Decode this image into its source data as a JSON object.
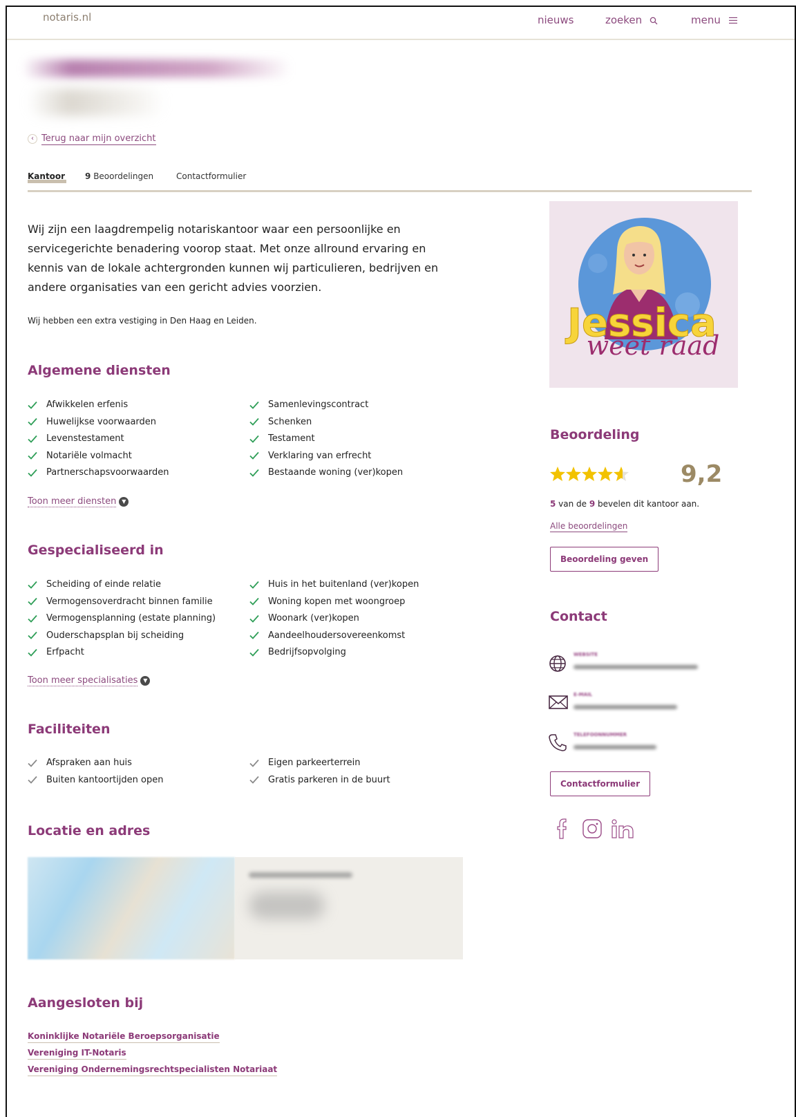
{
  "header": {
    "logo": "notaris.nl",
    "nav": {
      "news": "nieuws",
      "search": "zoeken",
      "menu": "menu"
    }
  },
  "back_link": "Terug naar mijn overzicht",
  "tabs": {
    "office": "Kantoor",
    "reviews_count": "9",
    "reviews_label": "Beoordelingen",
    "contact": "Contactformulier"
  },
  "intro": "Wij zijn een laagdrempelig notariskantoor waar een persoonlijke en servicegerichte benadering voorop staat. Met onze allround ervaring en kennis van de lokale achtergronden kunnen wij particulieren, bedrijven en andere organisaties van een gericht advies voorzien.",
  "extra_location": "Wij hebben een extra vestiging in Den Haag en Leiden.",
  "general_services": {
    "title": "Algemene diensten",
    "col1": [
      "Afwikkelen erfenis",
      "Huwelijkse voorwaarden",
      "Levenstestament",
      "Notariële volmacht",
      "Partnerschapsvoorwaarden"
    ],
    "col2": [
      "Samenlevingscontract",
      "Schenken",
      "Testament",
      "Verklaring van erfrecht",
      "Bestaande woning (ver)kopen"
    ],
    "more": "Toon meer diensten"
  },
  "specialized": {
    "title": "Gespecialiseerd in",
    "col1": [
      "Scheiding of einde relatie",
      "Vermogensoverdracht binnen familie",
      "Vermogensplanning (estate planning)",
      "Ouderschapsplan bij scheiding",
      "Erfpacht"
    ],
    "col2": [
      "Huis in het buitenland (ver)kopen",
      "Woning kopen met woongroep",
      "Woonark (ver)kopen",
      "Aandeelhoudersovereenkomst",
      "Bedrijfsopvolging"
    ],
    "more": "Toon meer specialisaties"
  },
  "facilities": {
    "title": "Faciliteiten",
    "col1": [
      "Afspraken aan huis",
      "Buiten kantoortijden open"
    ],
    "col2": [
      "Eigen parkeerterrein",
      "Gratis parkeren in de buurt"
    ]
  },
  "location_title": "Locatie en adres",
  "affiliations": {
    "title": "Aangesloten bij",
    "items": [
      "Koninklijke Notariële Beroepsorganisatie",
      "Vereniging IT-Notaris",
      "Vereniging Ondernemingsrechtspecialisten Notariaat"
    ]
  },
  "profile_image": {
    "line1": "Jessica",
    "line2": "weet raad"
  },
  "rating": {
    "title": "Beoordeling",
    "score": "9,2",
    "stars_value": 4.6,
    "recommend_count": "5",
    "recommend_mid": " van de ",
    "recommend_total": "9",
    "recommend_end": " bevelen dit kantoor aan.",
    "all_reviews": "Alle beoordelingen",
    "give_review": "Beoordeling geven"
  },
  "contact": {
    "title": "Contact",
    "website_label": "WEBSITE",
    "email_label": "E-MAIL",
    "phone_label": "TELEFOONNUMMER",
    "form_button": "Contactformulier"
  },
  "colors": {
    "brand": "#8c3a78",
    "check": "#2e9e57",
    "check_muted": "#8a8a8a",
    "star": "#f2c200",
    "score": "#9c8a65"
  }
}
